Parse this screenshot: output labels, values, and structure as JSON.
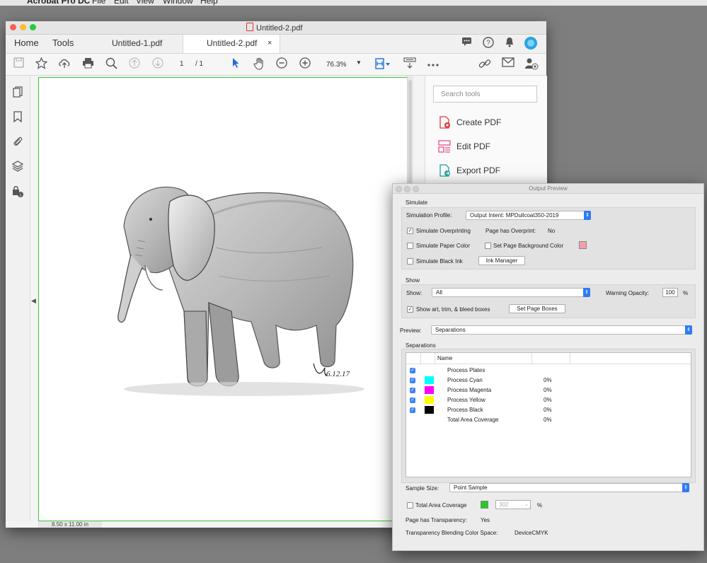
{
  "menubar": {
    "app_name": "Acrobat Pro DC",
    "items": [
      "File",
      "Edit",
      "View",
      "Window",
      "Help"
    ]
  },
  "window": {
    "title": "Untitled-2.pdf",
    "tabs": {
      "home": "Home",
      "tools": "Tools",
      "doc1": "Untitled-1.pdf",
      "doc2": "Untitled-2.pdf",
      "close": "×"
    }
  },
  "toolbar": {
    "page_current": "1",
    "page_total": "/ 1",
    "zoom": "76.3%"
  },
  "right_panel": {
    "search_placeholder": "Search tools",
    "tools": [
      {
        "label": "Create PDF",
        "icon": "create-pdf-icon",
        "color": "#e0393e"
      },
      {
        "label": "Edit PDF",
        "icon": "edit-pdf-icon",
        "color": "#e64f8a"
      },
      {
        "label": "Export PDF",
        "icon": "export-pdf-icon",
        "color": "#21a0a0"
      }
    ]
  },
  "status": {
    "page_size": "8.50 x 11.00 in"
  },
  "document": {
    "signature": "6.12.17"
  },
  "output_preview": {
    "title": "Output Preview",
    "simulate": {
      "section": "Simulate",
      "profile_label": "Simulation Profile:",
      "profile_value": "Output Intent: MPDullcoat350-2019",
      "overprinting": "Simulate Overprinting",
      "overprint_label": "Page has Overprint:",
      "overprint_value": "No",
      "paper_color": "Simulate Paper Color",
      "page_bg": "Set Page Background Color",
      "page_bg_color": "#f2a0a8",
      "black_ink": "Simulate Black Ink",
      "ink_manager": "Ink Manager"
    },
    "show": {
      "section": "Show",
      "show_label": "Show:",
      "show_value": "All",
      "warning_label": "Warning Opacity:",
      "warning_value": "100",
      "warning_unit": "%",
      "boxes": "Show art, trim, & bleed boxes",
      "set_boxes": "Set Page Boxes"
    },
    "preview": {
      "label": "Preview:",
      "value": "Separations"
    },
    "separations": {
      "section": "Separations",
      "col_name": "Name",
      "rows": [
        {
          "name": "Process Plates",
          "percent": "",
          "color": "",
          "checked": true
        },
        {
          "name": "Process Cyan",
          "percent": "0%",
          "color": "#00ffff",
          "checked": true
        },
        {
          "name": "Process Magenta",
          "percent": "0%",
          "color": "#ff00ff",
          "checked": true
        },
        {
          "name": "Process Yellow",
          "percent": "0%",
          "color": "#ffff00",
          "checked": true
        },
        {
          "name": "Process Black",
          "percent": "0%",
          "color": "#000000",
          "checked": true
        },
        {
          "name": "Total Area Coverage",
          "percent": "0%",
          "color": "",
          "checked": false
        }
      ]
    },
    "sample": {
      "label": "Sample Size:",
      "value": "Point Sample"
    },
    "coverage": {
      "label": "Total Area Coverage",
      "color": "#22cc22",
      "value": "302",
      "unit": "%"
    },
    "transparency": {
      "label": "Page has Transparency:",
      "value": "Yes",
      "space_label": "Transparency Blending Color Space:",
      "space_value": "DeviceCMYK"
    }
  }
}
